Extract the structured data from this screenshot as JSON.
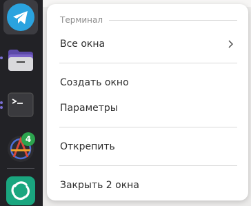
{
  "dock": {
    "items": [
      {
        "name": "telegram",
        "icon": "telegram-icon",
        "color": "#2aa3df"
      },
      {
        "name": "files",
        "icon": "folder-icon",
        "color": "#7c64c8"
      },
      {
        "name": "terminal",
        "icon": "terminal-icon",
        "color": "#3a3a3e"
      },
      {
        "name": "anarchy",
        "icon": "anarchy-icon",
        "badge": "4"
      },
      {
        "name": "element",
        "icon": "element-icon",
        "color": "#1aa67f"
      }
    ]
  },
  "menu": {
    "title": "Терминал",
    "items": [
      {
        "label": "Все окна",
        "has_submenu": true
      },
      {
        "label": "Создать окно"
      },
      {
        "label": "Параметры"
      },
      {
        "label": "Открепить"
      },
      {
        "label": "Закрыть 2 окна"
      }
    ]
  }
}
